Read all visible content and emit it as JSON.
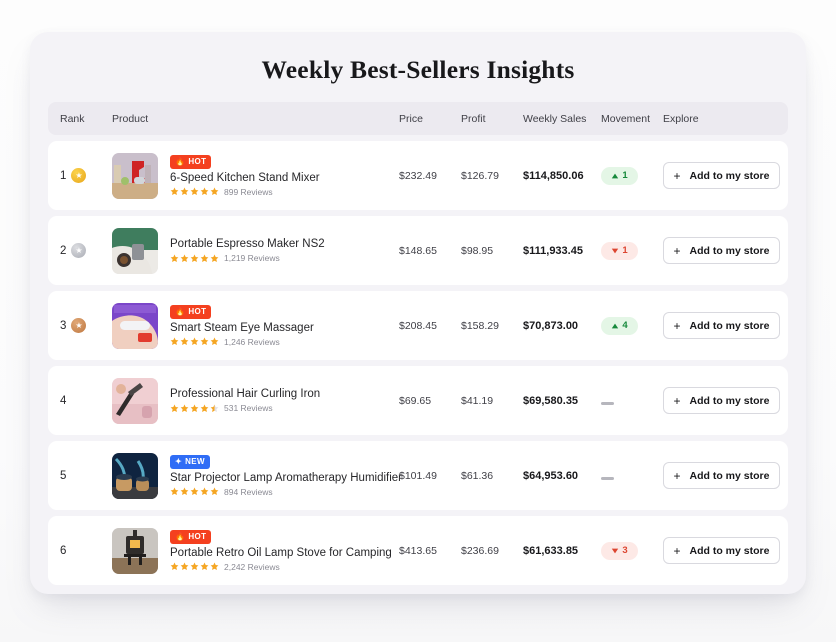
{
  "header": {
    "title": "Weekly Best-Sellers Insights",
    "columns": {
      "rank": "Rank",
      "product": "Product",
      "price": "Price",
      "profit": "Profit",
      "weekly_sales": "Weekly Sales",
      "movement": "Movement",
      "explore": "Explore"
    }
  },
  "button": {
    "add_label": "Add to my store",
    "plus_icon": "plus-icon"
  },
  "badges": {
    "hot": "HOT",
    "new": "NEW",
    "hot_icon": "flame-icon",
    "new_icon": "sparkle-icon"
  },
  "colors": {
    "page_bg": "#ffffff",
    "card_bg": "#f4f3f7",
    "header_bg": "#eceaf0",
    "row_bg": "#ffffff",
    "hot_badge": "#f4401f",
    "new_badge": "#2f6df6",
    "star": "#f5a623",
    "up": "#16893b",
    "up_bg": "#e4f6e6",
    "down": "#dc4530",
    "down_bg": "#fde9e6",
    "flat": "#b6b6bd",
    "gold": "#e8a61b",
    "silver": "#a9acb4",
    "bronze": "#bf7840"
  },
  "rows": [
    {
      "rank": "1",
      "medal": "gold",
      "badge": "HOT",
      "badge_type": "hot",
      "name": "6-Speed Kitchen Stand Mixer",
      "stars": 5,
      "reviews": "899 Reviews",
      "price": "$232.49",
      "profit": "$126.79",
      "sales": "$114,850.06",
      "movement": "1",
      "movement_dir": "up",
      "thumb": "stand-mixer"
    },
    {
      "rank": "2",
      "medal": "silver",
      "badge": "",
      "badge_type": "none",
      "name": "Portable Espresso Maker NS2",
      "stars": 5,
      "reviews": "1,219 Reviews",
      "price": "$148.65",
      "profit": "$98.95",
      "sales": "$111,933.45",
      "movement": "1",
      "movement_dir": "down",
      "thumb": "espresso-maker"
    },
    {
      "rank": "3",
      "medal": "bronze",
      "badge": "HOT",
      "badge_type": "hot",
      "name": "Smart Steam Eye Massager",
      "stars": 5,
      "reviews": "1,246 Reviews",
      "price": "$208.45",
      "profit": "$158.29",
      "sales": "$70,873.00",
      "movement": "4",
      "movement_dir": "up",
      "thumb": "eye-massager"
    },
    {
      "rank": "4",
      "medal": "none",
      "badge": "",
      "badge_type": "none",
      "name": "Professional Hair Curling Iron",
      "stars": 4.5,
      "reviews": "531 Reviews",
      "price": "$69.65",
      "profit": "$41.19",
      "sales": "$69,580.35",
      "movement": "",
      "movement_dir": "flat",
      "thumb": "curling-iron"
    },
    {
      "rank": "5",
      "medal": "none",
      "badge": "NEW",
      "badge_type": "new",
      "name": "Star Projector Lamp Aromatherapy Humidifier",
      "stars": 5,
      "reviews": "894 Reviews",
      "price": "$101.49",
      "profit": "$61.36",
      "sales": "$64,953.60",
      "movement": "",
      "movement_dir": "flat",
      "thumb": "humidifier"
    },
    {
      "rank": "6",
      "medal": "none",
      "badge": "HOT",
      "badge_type": "hot",
      "name": "Portable Retro Oil Lamp Stove for Camping",
      "stars": 5,
      "reviews": "2,242 Reviews",
      "price": "$413.65",
      "profit": "$236.69",
      "sales": "$61,633.85",
      "movement": "3",
      "movement_dir": "down",
      "thumb": "oil-lamp-stove"
    }
  ]
}
